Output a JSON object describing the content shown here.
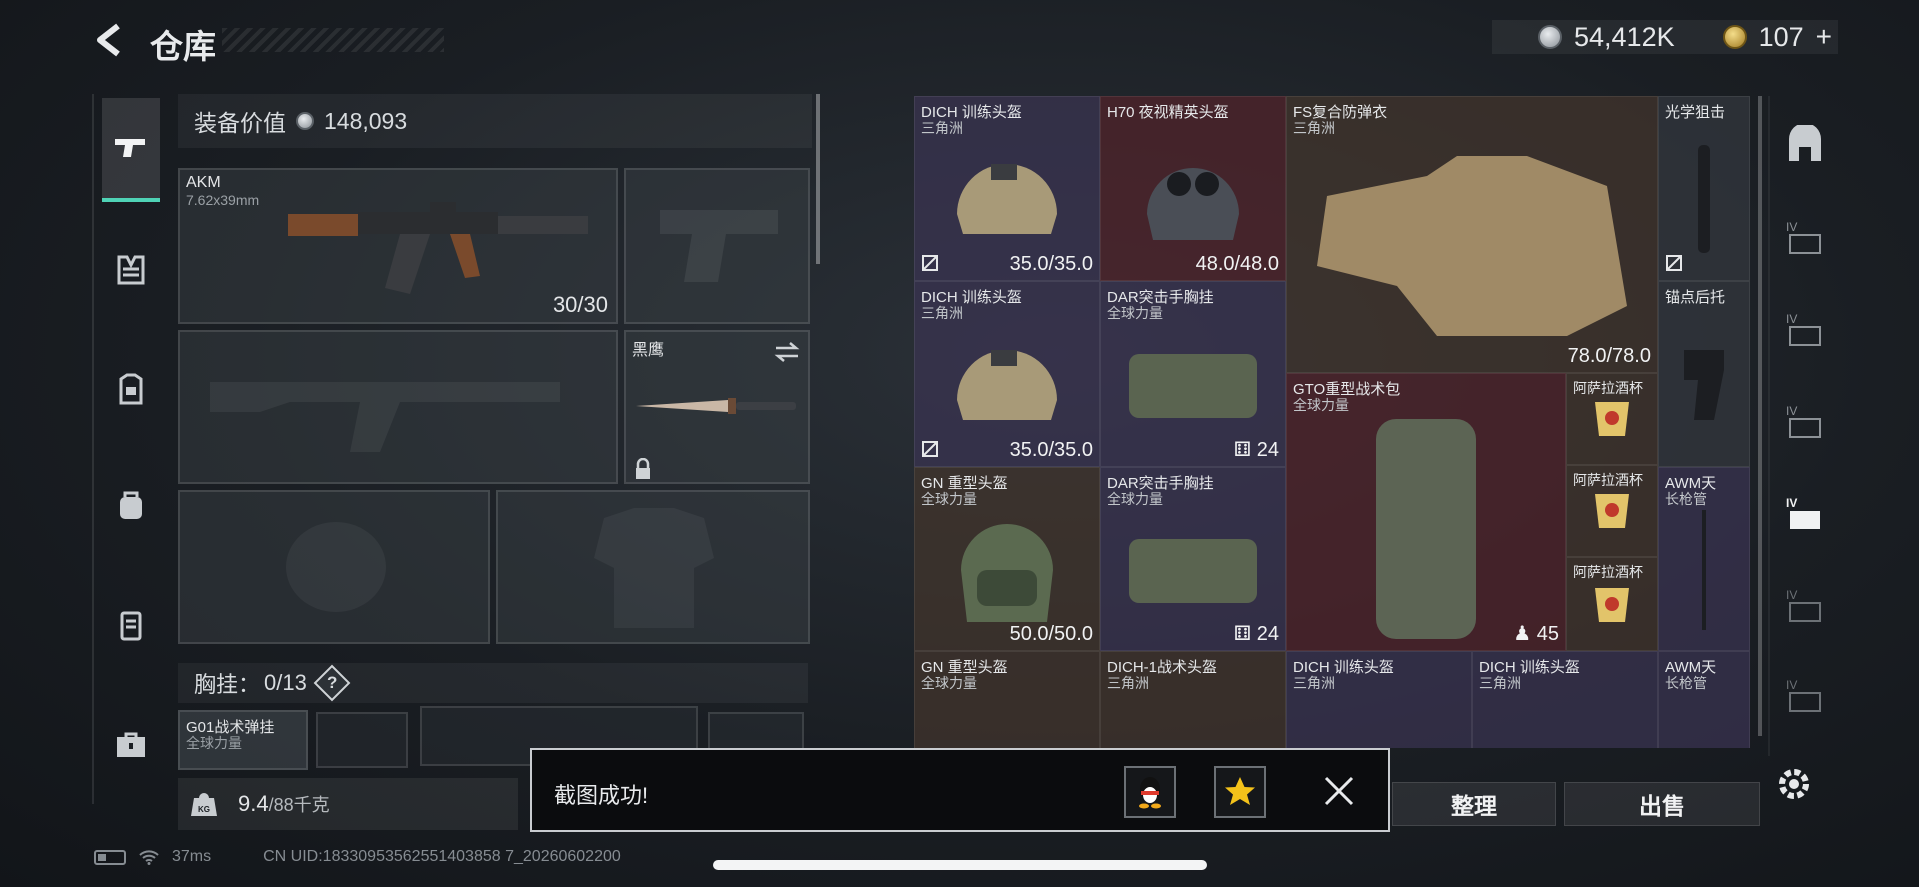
{
  "header": {
    "title": "仓库"
  },
  "currency": {
    "silver": "54,412K",
    "gold": "107",
    "gold_add": "+"
  },
  "equipment": {
    "value_label": "装备价值",
    "value": "148,093",
    "primary": {
      "name": "AKM",
      "caliber": "7.62x39mm",
      "ammo": "30/30"
    },
    "melee": {
      "name": "黑鹰"
    },
    "chest_rig_label": "胸挂：",
    "chest_rig_count": "0/13",
    "help": "?",
    "rig_item": {
      "name": "G01战术弹挂",
      "region": "全球力量"
    },
    "weight": "9.4",
    "weight_max": "/88千克"
  },
  "inventory": {
    "items": [
      {
        "name": "DICH 训练头盔",
        "region": "三角洲",
        "durability": "35.0/35.0"
      },
      {
        "name": "H70 夜视精英头盔",
        "region": "",
        "durability": "48.0/48.0"
      },
      {
        "name": "FS复合防弹衣",
        "region": "三角洲",
        "durability": "78.0/78.0"
      },
      {
        "name": "光学狙击"
      },
      {
        "name": "DICH 训练头盔",
        "region": "三角洲",
        "durability": "35.0/35.0"
      },
      {
        "name": "DAR突击手胸挂",
        "region": "全球力量",
        "count": "24"
      },
      {
        "name": "锚点后托"
      },
      {
        "name": "GTO重型战术包",
        "region": "全球力量",
        "count": "45"
      },
      {
        "name": "阿萨拉酒杯"
      },
      {
        "name": "GN 重型头盔",
        "region": "全球力量",
        "durability": "50.0/50.0"
      },
      {
        "name": "DAR突击手胸挂",
        "region": "全球力量",
        "count": "24"
      },
      {
        "name": "阿萨拉酒杯"
      },
      {
        "name": "AWM天",
        "region": "长枪管"
      },
      {
        "name": "阿萨拉酒杯"
      },
      {
        "name": "GN 重型头盔",
        "region": "全球力量"
      },
      {
        "name": "DICH-1战术头盔",
        "region": "三角洲"
      },
      {
        "name": "DICH 训练头盔",
        "region": "三角洲"
      },
      {
        "name": "DICH 训练头盔",
        "region": "三角洲"
      },
      {
        "name": "AWM天",
        "region": "长枪管"
      }
    ]
  },
  "actions": {
    "sort": "整理",
    "sell": "出售"
  },
  "toast": {
    "message": "截图成功!"
  },
  "status": {
    "ping": "37ms",
    "uid": "CN UID:18330953562551403858 7_20260602200"
  },
  "colors": {
    "accent": "#4fd3b6",
    "rarity_purple": "#564878",
    "rarity_red": "#6e2830",
    "rarity_gold": "#a27b22"
  }
}
